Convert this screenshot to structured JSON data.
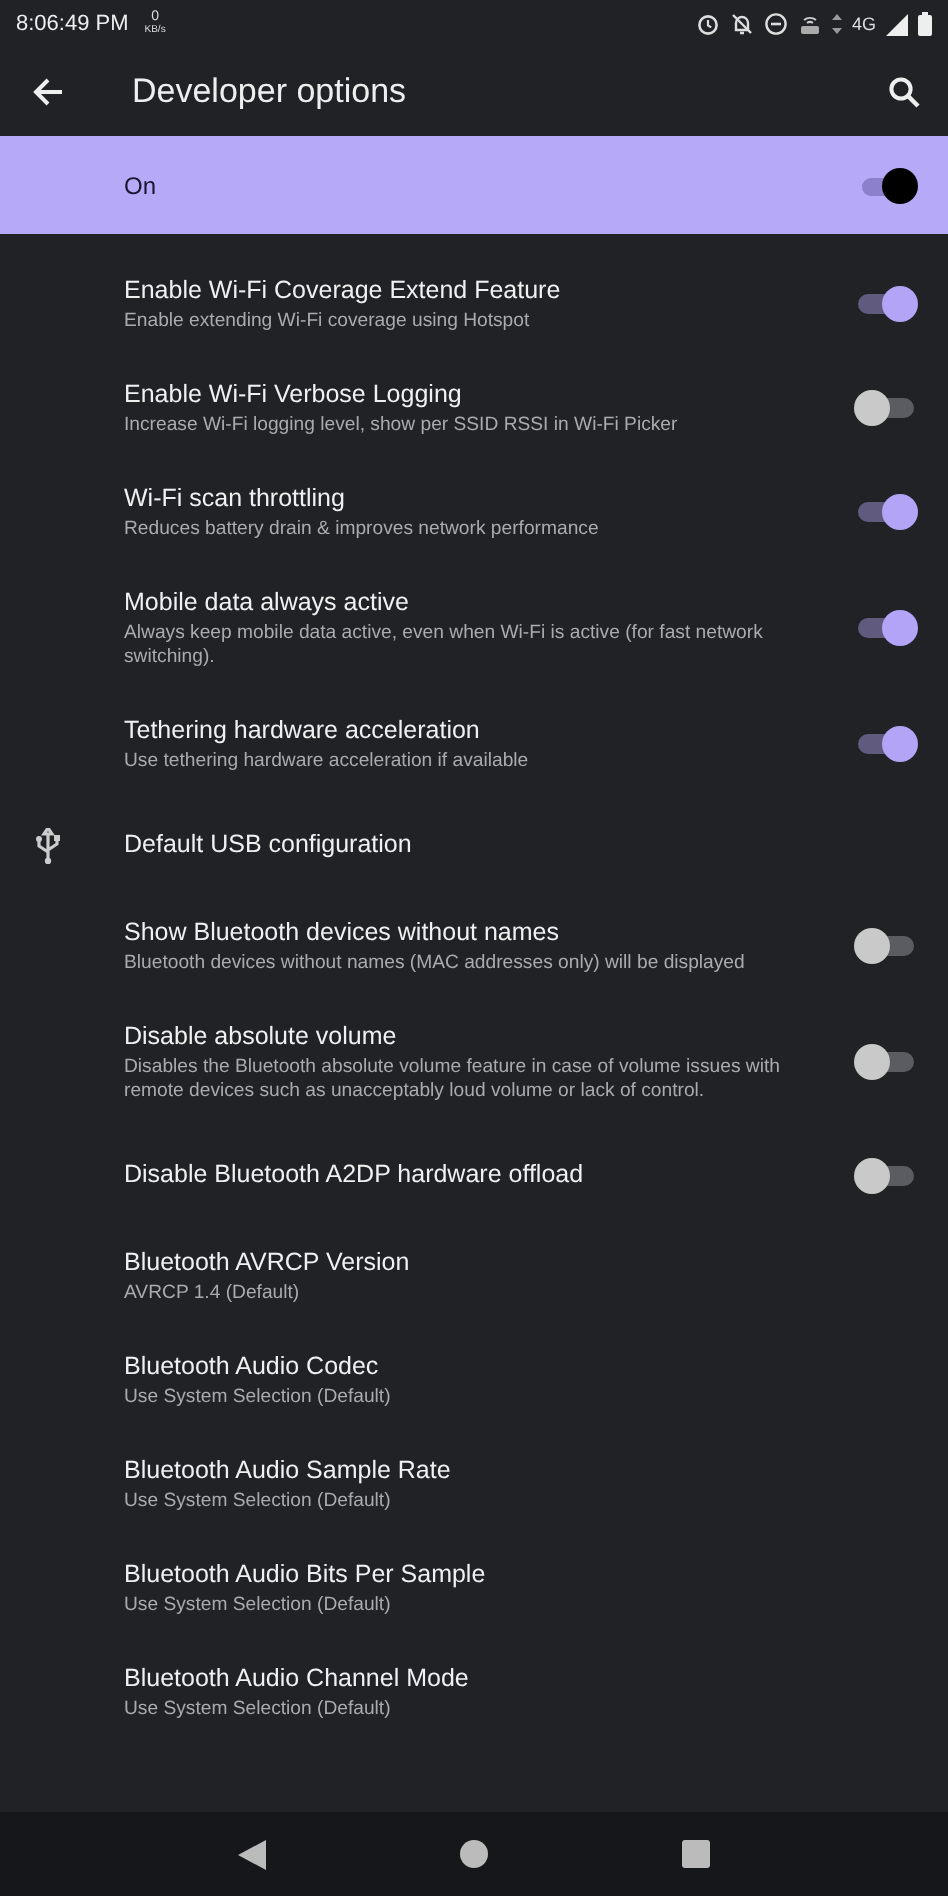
{
  "status_bar": {
    "time": "8:06:49 PM",
    "speed_value": "0",
    "speed_unit": "KB/s",
    "network": "4G"
  },
  "toolbar": {
    "title": "Developer options"
  },
  "master_switch": {
    "label": "On",
    "on": true
  },
  "settings": [
    {
      "kind": "toggle",
      "title": "Enable Wi-Fi Coverage Extend Feature",
      "summary": "Enable extending Wi-Fi coverage using Hotspot",
      "on": true
    },
    {
      "kind": "toggle",
      "title": "Enable Wi-Fi Verbose Logging",
      "summary": "Increase Wi-Fi logging level, show per SSID RSSI in Wi-Fi Picker",
      "on": false
    },
    {
      "kind": "toggle",
      "title": "Wi-Fi scan throttling",
      "summary": "Reduces battery drain & improves network performance",
      "on": true
    },
    {
      "kind": "toggle",
      "title": "Mobile data always active",
      "summary": "Always keep mobile data active, even when Wi-Fi is active (for fast network switching).",
      "on": true
    },
    {
      "kind": "toggle",
      "title": "Tethering hardware acceleration",
      "summary": "Use tethering hardware acceleration if available",
      "on": true
    },
    {
      "kind": "usb",
      "title": "Default USB configuration"
    },
    {
      "kind": "toggle",
      "title": "Show Bluetooth devices without names",
      "summary": "Bluetooth devices without names (MAC addresses only) will be displayed",
      "on": false
    },
    {
      "kind": "toggle",
      "title": "Disable absolute volume",
      "summary": "Disables the Bluetooth absolute volume feature in case of volume issues with remote devices such as unacceptably loud volume or lack of control.",
      "on": false
    },
    {
      "kind": "toggle",
      "title": "Disable Bluetooth A2DP hardware offload",
      "on": false
    },
    {
      "kind": "text",
      "title": "Bluetooth AVRCP Version",
      "summary": "AVRCP 1.4 (Default)"
    },
    {
      "kind": "text",
      "title": "Bluetooth Audio Codec",
      "summary": "Use System Selection (Default)"
    },
    {
      "kind": "text",
      "title": "Bluetooth Audio Sample Rate",
      "summary": "Use System Selection (Default)"
    },
    {
      "kind": "text",
      "title": "Bluetooth Audio Bits Per Sample",
      "summary": "Use System Selection (Default)"
    },
    {
      "kind": "text",
      "title": "Bluetooth Audio Channel Mode",
      "summary": "Use System Selection (Default)"
    }
  ]
}
